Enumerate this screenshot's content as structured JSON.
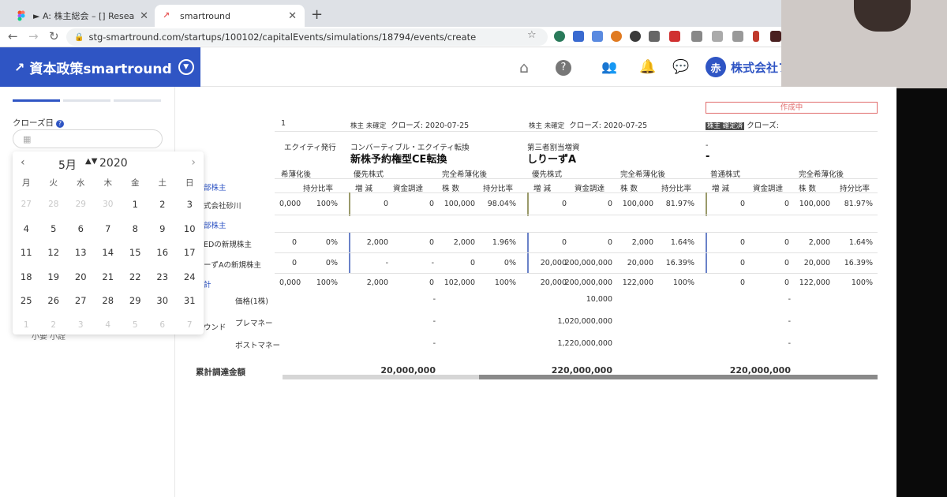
{
  "browser": {
    "tabs": [
      {
        "title": "► A: 株主総会 – [] Research an",
        "active": false
      },
      {
        "title": "smartround",
        "active": true
      }
    ],
    "url": "stg-smartround.com/startups/100102/capitalEvents/simulations/18794/events/create"
  },
  "header": {
    "brand": "資本政策smartround",
    "company_avatar": "赤",
    "company_name": "株式会社フ",
    "icons": [
      "home-icon",
      "help-icon",
      "users-icon",
      "bell-icon",
      "chat-icon"
    ]
  },
  "sidebar": {
    "close_date_label": "クローズ日",
    "close_date_value": "",
    "bottom_text": "小要 小詮"
  },
  "calendar": {
    "month": "5月",
    "year": "2020",
    "weekdays": [
      "月",
      "火",
      "水",
      "木",
      "金",
      "土",
      "日"
    ],
    "days": [
      {
        "d": "27",
        "m": true
      },
      {
        "d": "28",
        "m": true
      },
      {
        "d": "29",
        "m": true
      },
      {
        "d": "30",
        "m": true
      },
      {
        "d": "1",
        "m": false
      },
      {
        "d": "2",
        "m": false
      },
      {
        "d": "3",
        "m": false
      },
      {
        "d": "4",
        "m": false
      },
      {
        "d": "5",
        "m": false
      },
      {
        "d": "6",
        "m": false
      },
      {
        "d": "7",
        "m": false
      },
      {
        "d": "8",
        "m": false
      },
      {
        "d": "9",
        "m": false
      },
      {
        "d": "10",
        "m": false
      },
      {
        "d": "11",
        "m": false
      },
      {
        "d": "12",
        "m": false
      },
      {
        "d": "13",
        "m": false
      },
      {
        "d": "14",
        "m": false
      },
      {
        "d": "15",
        "m": false
      },
      {
        "d": "16",
        "m": false
      },
      {
        "d": "17",
        "m": false
      },
      {
        "d": "18",
        "m": false
      },
      {
        "d": "19",
        "m": false
      },
      {
        "d": "20",
        "m": false
      },
      {
        "d": "21",
        "m": false
      },
      {
        "d": "22",
        "m": false
      },
      {
        "d": "23",
        "m": false
      },
      {
        "d": "24",
        "m": false
      },
      {
        "d": "25",
        "m": false
      },
      {
        "d": "26",
        "m": false
      },
      {
        "d": "27",
        "m": false
      },
      {
        "d": "28",
        "m": false
      },
      {
        "d": "29",
        "m": false
      },
      {
        "d": "30",
        "m": false
      },
      {
        "d": "31",
        "m": false
      },
      {
        "d": "1",
        "m": true
      },
      {
        "d": "2",
        "m": true
      },
      {
        "d": "3",
        "m": true
      },
      {
        "d": "4",
        "m": true
      },
      {
        "d": "5",
        "m": true
      },
      {
        "d": "6",
        "m": true
      },
      {
        "d": "7",
        "m": true
      }
    ]
  },
  "main": {
    "status": "作成中",
    "columns": [
      {
        "num": "1",
        "close_tag": "株主 未確定",
        "close": "クローズ: 2020-07-25"
      },
      {
        "num": "",
        "close_tag": "株主 未確定",
        "close": "クローズ: 2020-07-25"
      },
      {
        "num": "",
        "close_tag": "株主 確定済",
        "close": "クローズ:"
      }
    ],
    "event_type_1": "エクイティ発行",
    "event_sub_2": "コンバーティブル・エクイティ転換",
    "event_name_2": "新株予約権型CE転換",
    "event_sub_3": "第三者割当増資",
    "event_name_3": "しりーずA",
    "event_sub_4": "-",
    "event_name_4": "-",
    "group_headers": [
      "希薄化後",
      "優先株式",
      "完全希薄化後",
      "優先株式",
      "完全希薄化後",
      "普通株式",
      "完全希薄化後"
    ],
    "sub_headers": {
      "g1": [
        "持分比率"
      ],
      "g2": [
        "増 減",
        "資金調達",
        "株 数",
        "持分比率"
      ],
      "g3": [
        "増 減",
        "資金調達",
        "株 数",
        "持分比率"
      ],
      "g4": [
        "増 減",
        "資金調達",
        "株 数",
        "持分比率"
      ]
    },
    "section_1": "部株主",
    "section_2": "部株主",
    "rows": [
      {
        "name": "式会社砂川",
        "c1": [
          "0,000",
          "100%"
        ],
        "c2": [
          "0",
          "0",
          "100,000",
          "98.04%"
        ],
        "c3": [
          "0",
          "0",
          "100,000",
          "81.97%"
        ],
        "c4": [
          "0",
          "0",
          "100,000",
          "81.97%"
        ]
      },
      {
        "name": "EDの新規株主",
        "c1": [
          "0",
          "0%"
        ],
        "c2": [
          "2,000",
          "0",
          "2,000",
          "1.96%"
        ],
        "c3": [
          "0",
          "0",
          "2,000",
          "1.64%"
        ],
        "c4": [
          "0",
          "0",
          "2,000",
          "1.64%"
        ]
      },
      {
        "name": "ーずAの新規株主",
        "c1": [
          "0",
          "0%"
        ],
        "c2": [
          "-",
          "-",
          "0",
          "0%"
        ],
        "c3": [
          "20,000",
          "200,000,000",
          "20,000",
          "16.39%"
        ],
        "c4": [
          "0",
          "0",
          "20,000",
          "16.39%"
        ]
      },
      {
        "name": "計",
        "c1": [
          "0,000",
          "100%"
        ],
        "c2": [
          "2,000",
          "0",
          "102,000",
          "100%"
        ],
        "c3": [
          "20,000",
          "200,000,000",
          "122,000",
          "100%"
        ],
        "c4": [
          "0",
          "0",
          "122,000",
          "100%"
        ]
      }
    ],
    "round_label": "ウンド",
    "round_rows": [
      {
        "label": "価格(1株)",
        "v2": "-",
        "v3": "10,000",
        "v4": "-"
      },
      {
        "label": "プレマネー",
        "v2": "-",
        "v3": "1,020,000,000",
        "v4": "-"
      },
      {
        "label": "ポストマネー",
        "v2": "-",
        "v3": "1,220,000,000",
        "v4": "-"
      }
    ],
    "total_label": "累計調達金額",
    "totals": [
      "20,000,000",
      "220,000,000",
      "220,000,000"
    ],
    "progress": 0.67
  },
  "colors": {
    "brand": "#2f55c4",
    "status": "#e06b6b",
    "sep_olive": "#9a9a6a",
    "sep_blue": "#6a82c8"
  }
}
